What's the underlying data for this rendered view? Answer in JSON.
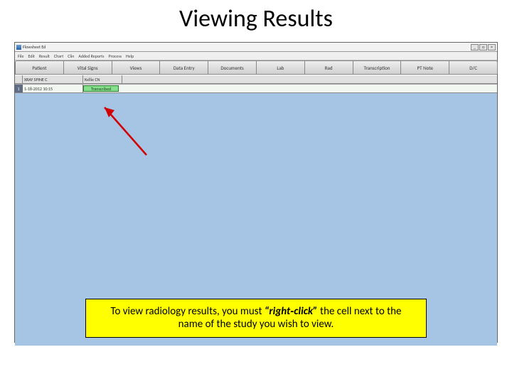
{
  "title": "Viewing Results",
  "screenshot": {
    "window_title": "Flowsheet  Ed",
    "window_controls": {
      "min": "_",
      "max": "□",
      "close": "×"
    },
    "menu": [
      "File",
      "Edit",
      "Result",
      "Chart",
      "Clin",
      "Added Reports",
      "Process",
      "Help"
    ],
    "tabs": [
      "Patient",
      "Vital Signs",
      "Views",
      "Data Entry",
      "Documents",
      "Lab",
      "Rad",
      "Transcription",
      "PT Note",
      "D/C"
    ],
    "column_headers": {
      "a": "XRAY SPINE C",
      "b": "Kellie CN"
    },
    "row": {
      "num": "1",
      "a": "1-18-2012 10:15",
      "b": "Transcribed"
    }
  },
  "instruction": {
    "pre": "To view radiology results, you must ",
    "em": "“right‑click”",
    "post": " the cell next to the name of the study you wish to view."
  }
}
